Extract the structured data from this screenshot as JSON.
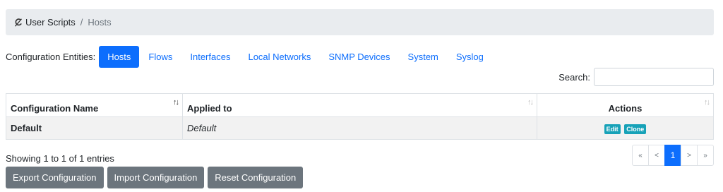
{
  "breadcrumb": {
    "icon": "scripts-icon",
    "parent": "User Scripts",
    "separator": "/",
    "current": "Hosts"
  },
  "entities": {
    "label": "Configuration Entities:",
    "tabs": [
      {
        "label": "Hosts",
        "active": true
      },
      {
        "label": "Flows"
      },
      {
        "label": "Interfaces"
      },
      {
        "label": "Local Networks"
      },
      {
        "label": "SNMP Devices"
      },
      {
        "label": "System"
      },
      {
        "label": "Syslog"
      }
    ]
  },
  "search": {
    "label": "Search:",
    "value": ""
  },
  "table": {
    "columns": [
      "Configuration Name",
      "Applied to",
      "Actions"
    ],
    "rows": [
      {
        "name": "Default",
        "applied_to": "Default",
        "actions": [
          "Edit",
          "Clone"
        ]
      }
    ]
  },
  "info": "Showing 1 to 1 of 1 entries",
  "pagination": {
    "first": "«",
    "prev": "<",
    "page": "1",
    "next": ">",
    "last": "»"
  },
  "buttons": {
    "export": "Export Configuration",
    "import": "Import Configuration",
    "reset": "Reset Configuration"
  },
  "colors": {
    "accent": "#0d6efd",
    "badge": "#17a2b8",
    "button": "#6c757d"
  }
}
